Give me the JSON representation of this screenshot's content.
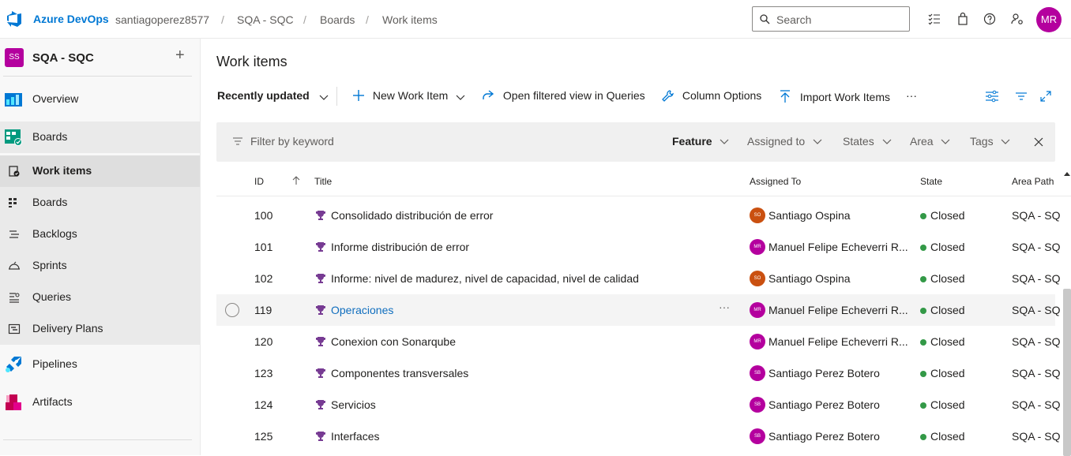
{
  "topbar": {
    "brand": "Azure DevOps",
    "breadcrumb": [
      "santiagoperez8577",
      "SQA - SQC",
      "Boards",
      "Work items"
    ],
    "search_placeholder": "Search",
    "user_initials": "MR"
  },
  "sidebar": {
    "project_initials": "SS",
    "project_name": "SQA - SQC",
    "add_symbol": "+",
    "items": [
      {
        "label": "Overview",
        "icon": "overview-icon"
      },
      {
        "label": "Boards",
        "icon": "boards-icon"
      },
      {
        "label": "Work items",
        "icon": "work-items-icon"
      },
      {
        "label": "Boards",
        "icon": "board-columns-icon"
      },
      {
        "label": "Backlogs",
        "icon": "backlogs-icon"
      },
      {
        "label": "Sprints",
        "icon": "sprints-icon"
      },
      {
        "label": "Queries",
        "icon": "queries-icon"
      },
      {
        "label": "Delivery Plans",
        "icon": "delivery-plans-icon"
      },
      {
        "label": "Pipelines",
        "icon": "pipelines-icon"
      },
      {
        "label": "Artifacts",
        "icon": "artifacts-icon"
      }
    ]
  },
  "main": {
    "title": "Work items",
    "toolbar": {
      "view": "Recently updated",
      "new_item": "New Work Item",
      "open_queries": "Open filtered view in Queries",
      "column_options": "Column Options",
      "import": "Import Work Items",
      "more": "···"
    },
    "filter": {
      "placeholder": "Filter by keyword",
      "type": "Feature",
      "assigned": "Assigned to",
      "states": "States",
      "area": "Area",
      "tags": "Tags"
    },
    "columns": {
      "id": "ID",
      "title": "Title",
      "assigned": "Assigned To",
      "state": "State",
      "area": "Area Path"
    },
    "rows": [
      {
        "id": "100",
        "title": "Consolidado distribución de error",
        "initials": "SO",
        "assigned": "Santiago Ospina",
        "state": "Closed",
        "area": "SQA - SQC"
      },
      {
        "id": "101",
        "title": "Informe distribución de error",
        "initials": "MR",
        "assigned": "Manuel Felipe Echeverri R...",
        "state": "Closed",
        "area": "SQA - SQC"
      },
      {
        "id": "102",
        "title": "Informe: nivel de madurez, nivel de capacidad, nivel de calidad",
        "initials": "SO",
        "assigned": "Santiago Ospina",
        "state": "Closed",
        "area": "SQA - SQC"
      },
      {
        "id": "119",
        "title": "Operaciones",
        "initials": "MR",
        "assigned": "Manuel Felipe Echeverri R...",
        "state": "Closed",
        "area": "SQA - SQC"
      },
      {
        "id": "120",
        "title": "Conexion con Sonarqube",
        "initials": "MR",
        "assigned": "Manuel Felipe Echeverri R...",
        "state": "Closed",
        "area": "SQA - SQC"
      },
      {
        "id": "123",
        "title": "Componentes transversales",
        "initials": "SB",
        "assigned": "Santiago Perez Botero",
        "state": "Closed",
        "area": "SQA - SQC"
      },
      {
        "id": "124",
        "title": "Servicios",
        "initials": "SB",
        "assigned": "Santiago Perez Botero",
        "state": "Closed",
        "area": "SQA - SQC"
      },
      {
        "id": "125",
        "title": "Interfaces",
        "initials": "SB",
        "assigned": "Santiago Perez Botero",
        "state": "Closed",
        "area": "SQA - SQC"
      }
    ]
  },
  "colors": {
    "accent": "#0078d4",
    "closed": "#339947",
    "so": "#ca5010",
    "magenta": "#b4009e",
    "trophy": "#773b93"
  }
}
